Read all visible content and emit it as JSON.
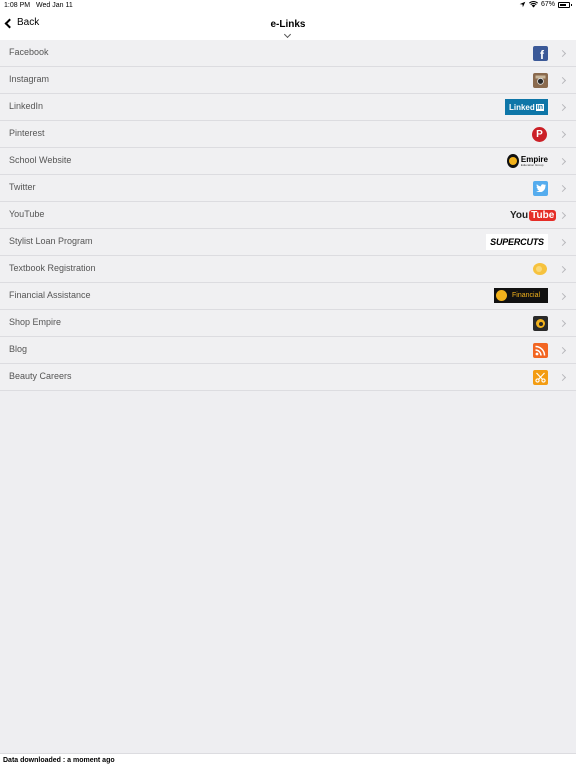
{
  "status_bar": {
    "time": "1:08 PM",
    "date": "Wed Jan 11",
    "battery": "67%"
  },
  "nav": {
    "back_label": "Back",
    "title": "e-Links"
  },
  "items": [
    {
      "label": "Facebook",
      "icon": "facebook-icon"
    },
    {
      "label": "Instagram",
      "icon": "instagram-icon"
    },
    {
      "label": "LinkedIn",
      "icon": "linkedin-logo",
      "logo_text": "Linked",
      "logo_in": "in"
    },
    {
      "label": "Pinterest",
      "icon": "pinterest-icon"
    },
    {
      "label": "School Website",
      "icon": "empire-logo",
      "logo_text": "Empire",
      "logo_sub": "Education Group"
    },
    {
      "label": "Twitter",
      "icon": "twitter-icon"
    },
    {
      "label": "YouTube",
      "icon": "youtube-logo",
      "logo_text": "You",
      "logo_tube": "Tube"
    },
    {
      "label": "Stylist Loan Program",
      "icon": "supercuts-logo",
      "logo_text": "SUPERCUTS"
    },
    {
      "label": "Textbook Registration",
      "icon": "textbook-icon"
    },
    {
      "label": "Financial Assistance",
      "icon": "financial-logo",
      "logo_text": "Financial"
    },
    {
      "label": "Shop Empire",
      "icon": "shop-empire-icon"
    },
    {
      "label": "Blog",
      "icon": "blog-rss-icon"
    },
    {
      "label": "Beauty Careers",
      "icon": "scissors-icon"
    }
  ],
  "footer": {
    "text": "Data downloaded : a moment ago"
  },
  "colors": {
    "facebook": "#3b5998",
    "linkedin": "#0e76a8",
    "pinterest": "#cb2027",
    "twitter": "#55acee",
    "youtube": "#e52d27",
    "orange": "#f39c12",
    "gold": "#f2b21c"
  }
}
